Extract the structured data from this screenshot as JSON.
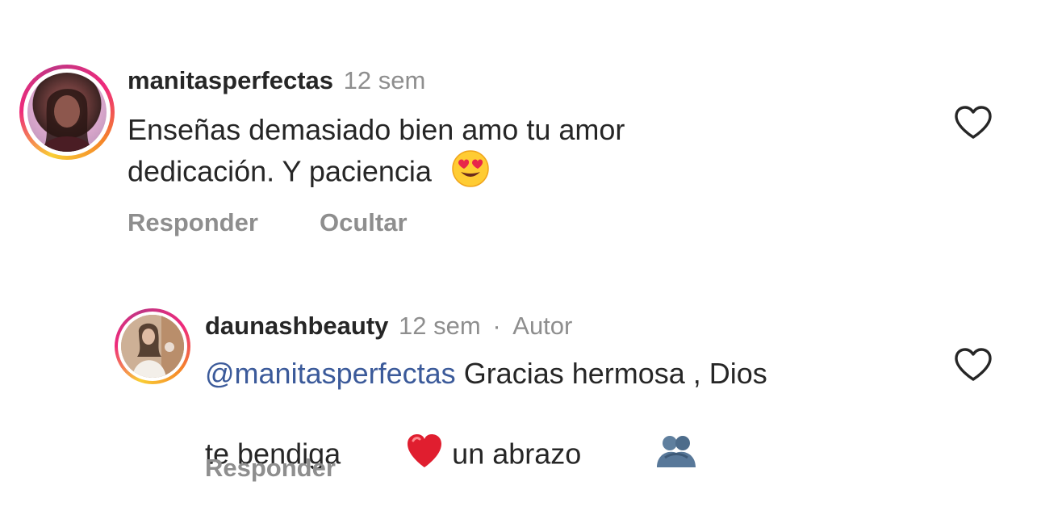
{
  "comments": [
    {
      "username": "manitasperfectas",
      "time": "12 sem",
      "text_line1": "Enseñas demasiado bien amo tu amor",
      "text_line2": "dedicación. Y paciencia",
      "emoji_icon": "heart-eyes-emoji",
      "actions": {
        "reply": "Responder",
        "hide": "Ocultar"
      }
    },
    {
      "username": "daunashbeauty",
      "time": "12 sem",
      "separator": "·",
      "author_label": "Autor",
      "mention": "@manitasperfectas",
      "text_line1_rest": " Gracias hermosa , Dios",
      "text_line2": "te bendiga",
      "text_line2_rest": " un abrazo ",
      "emoji_icons": [
        "red-heart-emoji",
        "people-hugging-emoji"
      ],
      "actions": {
        "reply": "Responder"
      }
    }
  ],
  "colors": {
    "text": "#262626",
    "muted": "#8e8e8e",
    "mention": "#3b5a9a",
    "heart_outline": "#262626"
  }
}
